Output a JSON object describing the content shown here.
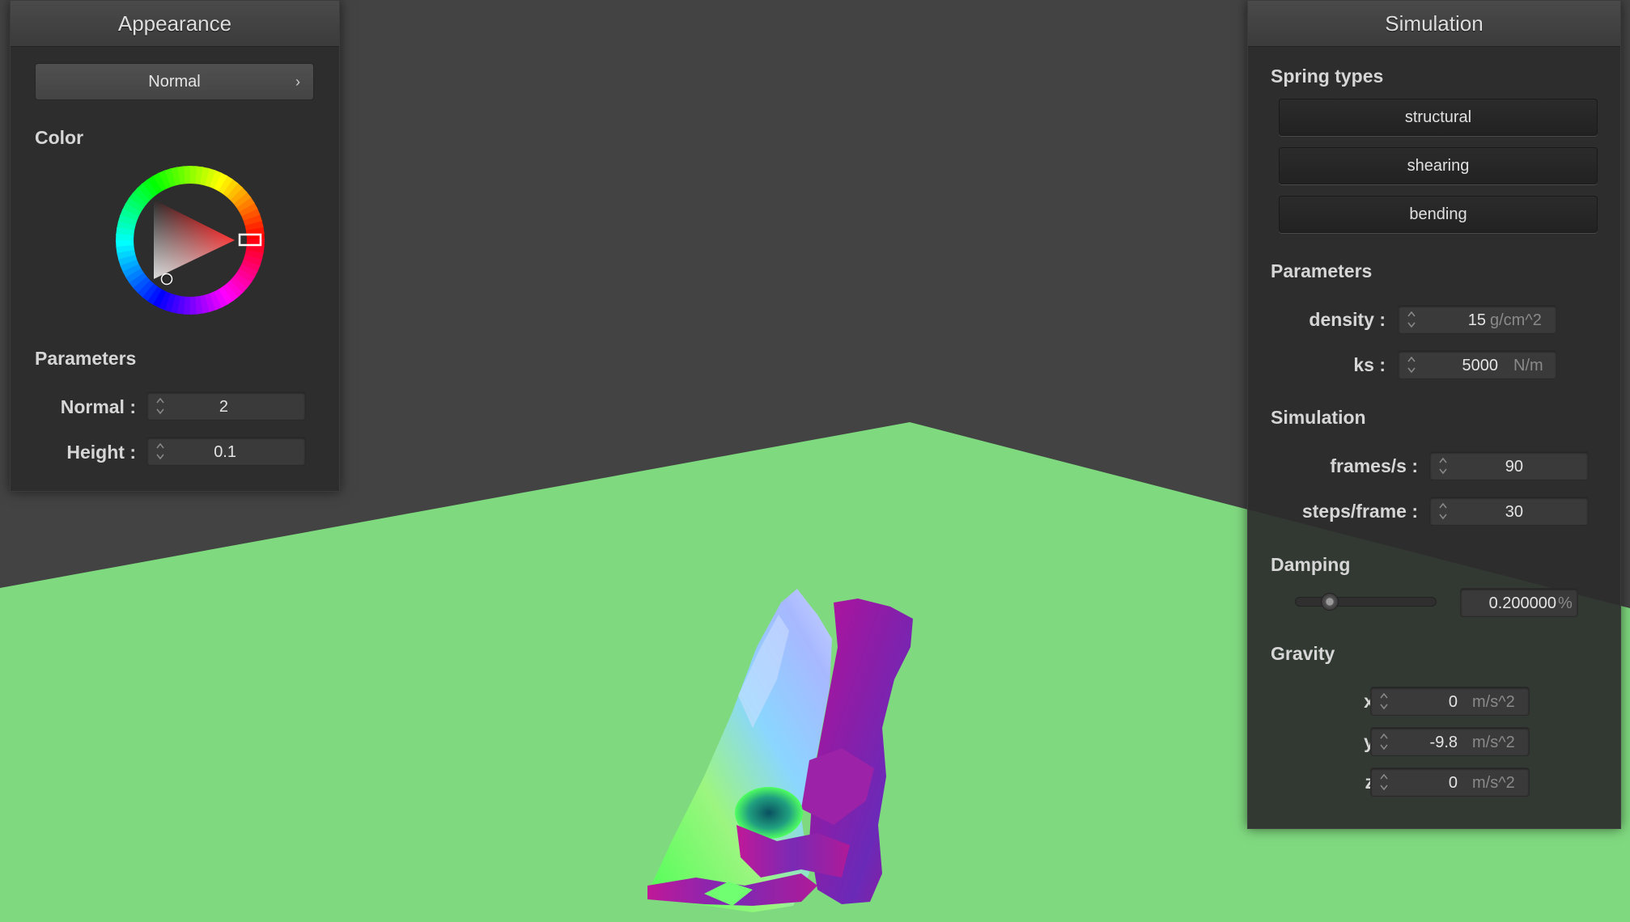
{
  "appearance": {
    "title": "Appearance",
    "shader_select": {
      "value": "Normal",
      "chevron_icon": "chevron-right-icon"
    },
    "color_title": "Color",
    "color_wheel": {
      "hue": "#ff0000",
      "selected_color": "#ffffff"
    },
    "parameters_title": "Parameters",
    "normal": {
      "label": "Normal :",
      "value": "2"
    },
    "height": {
      "label": "Height :",
      "value": "0.1"
    }
  },
  "simulation": {
    "title": "Simulation",
    "spring_types_title": "Spring types",
    "springs": [
      {
        "label": "structural"
      },
      {
        "label": "shearing"
      },
      {
        "label": "bending"
      }
    ],
    "parameters_title": "Parameters",
    "density": {
      "label": "density :",
      "value": "15",
      "unit": "g/cm^2"
    },
    "ks": {
      "label": "ks :",
      "value": "5000",
      "unit": "N/m"
    },
    "sim_title": "Simulation",
    "fps": {
      "label": "frames/s :",
      "value": "90"
    },
    "steps": {
      "label": "steps/frame :",
      "value": "30"
    },
    "damping_title": "Damping",
    "damping": {
      "value": "0.200000",
      "unit": "%",
      "slider_fraction": 0.2
    },
    "gravity_title": "Gravity",
    "gx": {
      "label": "x :",
      "value": "0",
      "unit": "m/s^2"
    },
    "gy": {
      "label": "y :",
      "value": "-9.8",
      "unit": "m/s^2"
    },
    "gz": {
      "label": "z :",
      "value": "0",
      "unit": "m/s^2"
    }
  },
  "scene": {
    "background_color": "#434343",
    "floor_color": "#7fd97f",
    "cloth_shading": "normal-map colored cloth"
  }
}
